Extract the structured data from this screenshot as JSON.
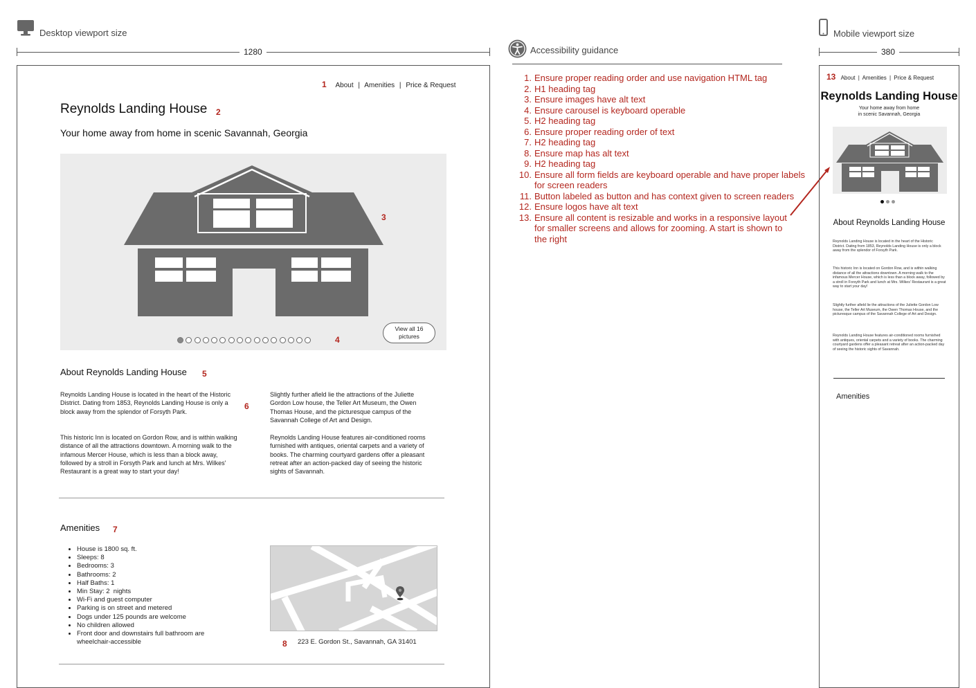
{
  "desktop": {
    "label": "Desktop viewport size",
    "width_label": "1280",
    "nav": {
      "marker": "1",
      "items": [
        "About",
        "Amenities",
        "Price & Request"
      ],
      "sep": "|"
    },
    "title": "Reynolds Landing House",
    "title_marker": "2",
    "subtitle": "Your home away from home in scenic Savannah, Georgia",
    "carousel": {
      "marker": "3",
      "dots_marker": "4",
      "dot_count": 16,
      "active_dot": 1,
      "view_all_label": "View all 16 pictures"
    },
    "about": {
      "heading": "About Reynolds Landing House",
      "heading_marker": "5",
      "text_marker": "6",
      "p1": "Reynolds Landing House is located in the heart of the Historic District. Dating from 1853, Reynolds Landing House is only a block away from the splendor of Forsyth Park.",
      "p2": "This historic Inn is located on Gordon Row, and is within walking distance of all the attractions downtown. A morning walk to the infamous Mercer House, which is less than a block away, followed by a stroll in Forsyth Park and lunch at Mrs. Wilkes' Restaurant is a great way to start your day!",
      "p3": "Slightly further afield lie the attractions of the Juliette Gordon Low house, the Teller Art Museum, the Owen Thomas House, and the picturesque campus of the Savannah College of Art and Design.",
      "p4": "Reynolds Landing House features air-conditioned rooms furnished with antiques, oriental carpets and a variety of books. The charming courtyard gardens offer a pleasant retreat after an action-packed day of seeing the historic sights of Savannah."
    },
    "amenities": {
      "heading": "Amenities",
      "heading_marker": "7",
      "items": [
        "House is 1800 sq. ft.",
        "Sleeps: 8",
        "Bedrooms: 3",
        "Bathrooms: 2",
        "Half Baths: 1",
        "Min Stay: 2  nights",
        "Wi-Fi and guest computer",
        "Parking is on street and metered",
        "Dogs under 125 pounds are welcome",
        "No children allowed",
        "Front door and downstairs full bathroom are wheelchair-accessible"
      ],
      "map_marker": "8",
      "address": "223 E. Gordon St., Savannah, GA 31401"
    }
  },
  "guidance": {
    "heading": "Accessibility guidance",
    "items": [
      {
        "n": "1.",
        "text": "Ensure proper reading order and use navigation HTML tag"
      },
      {
        "n": "2.",
        "text": "H1 heading tag"
      },
      {
        "n": "3.",
        "text": "Ensure images have alt text"
      },
      {
        "n": "4.",
        "text": "Ensure carousel is keyboard operable"
      },
      {
        "n": "5.",
        "text": "H2 heading tag"
      },
      {
        "n": "6.",
        "text": "Ensure proper reading order of text"
      },
      {
        "n": "7.",
        "text": "H2 heading tag"
      },
      {
        "n": "8.",
        "text": "Ensure map has alt text"
      },
      {
        "n": "9.",
        "text": "H2 heading tag"
      },
      {
        "n": "10.",
        "text": "Ensure all form fields are keyboard operable and have proper labels for screen readers"
      },
      {
        "n": "11.",
        "text": "Button labeled as button and has context given to screen readers"
      },
      {
        "n": "12.",
        "text": "Ensure logos have alt text"
      },
      {
        "n": "13.",
        "text": "Ensure all content is resizable and works in a responsive layout for smaller screens and allows for zooming. A start is shown to the right"
      }
    ]
  },
  "mobile": {
    "label": "Mobile viewport size",
    "width_label": "380",
    "marker": "13",
    "nav": [
      "About",
      "Amenities",
      "Price & Request"
    ],
    "title": "Reynolds Landing House",
    "subtitle_line1": "Your home away from home",
    "subtitle_line2": "in scenic Savannah, Georgia",
    "about_heading": "About Reynolds Landing House",
    "p1": "Reynolds Landing House is located in the heart of the Historic District. Dating from 1853, Reynolds Landing House is only a block away from the splendor of Forsyth Park.",
    "p2": "This historic Inn is located on Gordon Row, and is within walking distance of all the attractions downtown. A morning walk to the infamous Mercer House, which is less than a block away, followed by a stroll in Forsyth Park and lunch at Mrs. Wilkes' Restaurant is a great way to start your day!",
    "p3": "Slightly further afield lie the attractions of the Juliette Gordon Low house, the Teller Art Museum, the Owen Thomas House, and the picturesque campus of the Savannah College of Art and Design.",
    "p4": "Reynolds Landing House features air-conditioned rooms furnished with antiques, oriental carpets and a variety of books. The charming courtyard gardens offer a pleasant retreat after an action-packed day of seeing the historic sights of Savannah.",
    "amenities_heading": "Amenities"
  },
  "colors": {
    "annotation": "#b3261e",
    "house": "#6b6b6b",
    "image_bg": "#ececec",
    "map_bg": "#d6d6d6"
  }
}
